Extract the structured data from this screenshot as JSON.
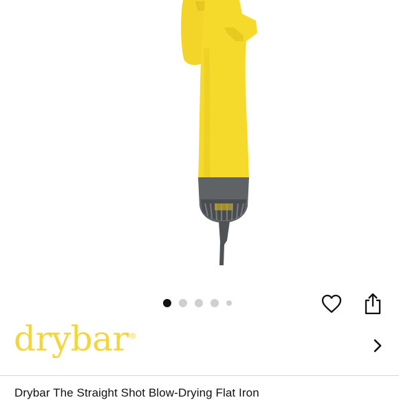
{
  "product": {
    "brand_logo_text": "drybar",
    "brand_logo_mark": "®",
    "title": "Drybar The Straight Shot Blow-Drying Flat Iron"
  },
  "gallery": {
    "image_count": 5,
    "active_index": 0
  },
  "actions": {
    "favorite_icon": "heart-icon",
    "share_icon": "share-icon",
    "brand_link_icon": "chevron-right-icon"
  },
  "colors": {
    "brand_yellow": "#f4d63a",
    "product_yellow": "#f6da2b",
    "product_gray": "#606365"
  }
}
